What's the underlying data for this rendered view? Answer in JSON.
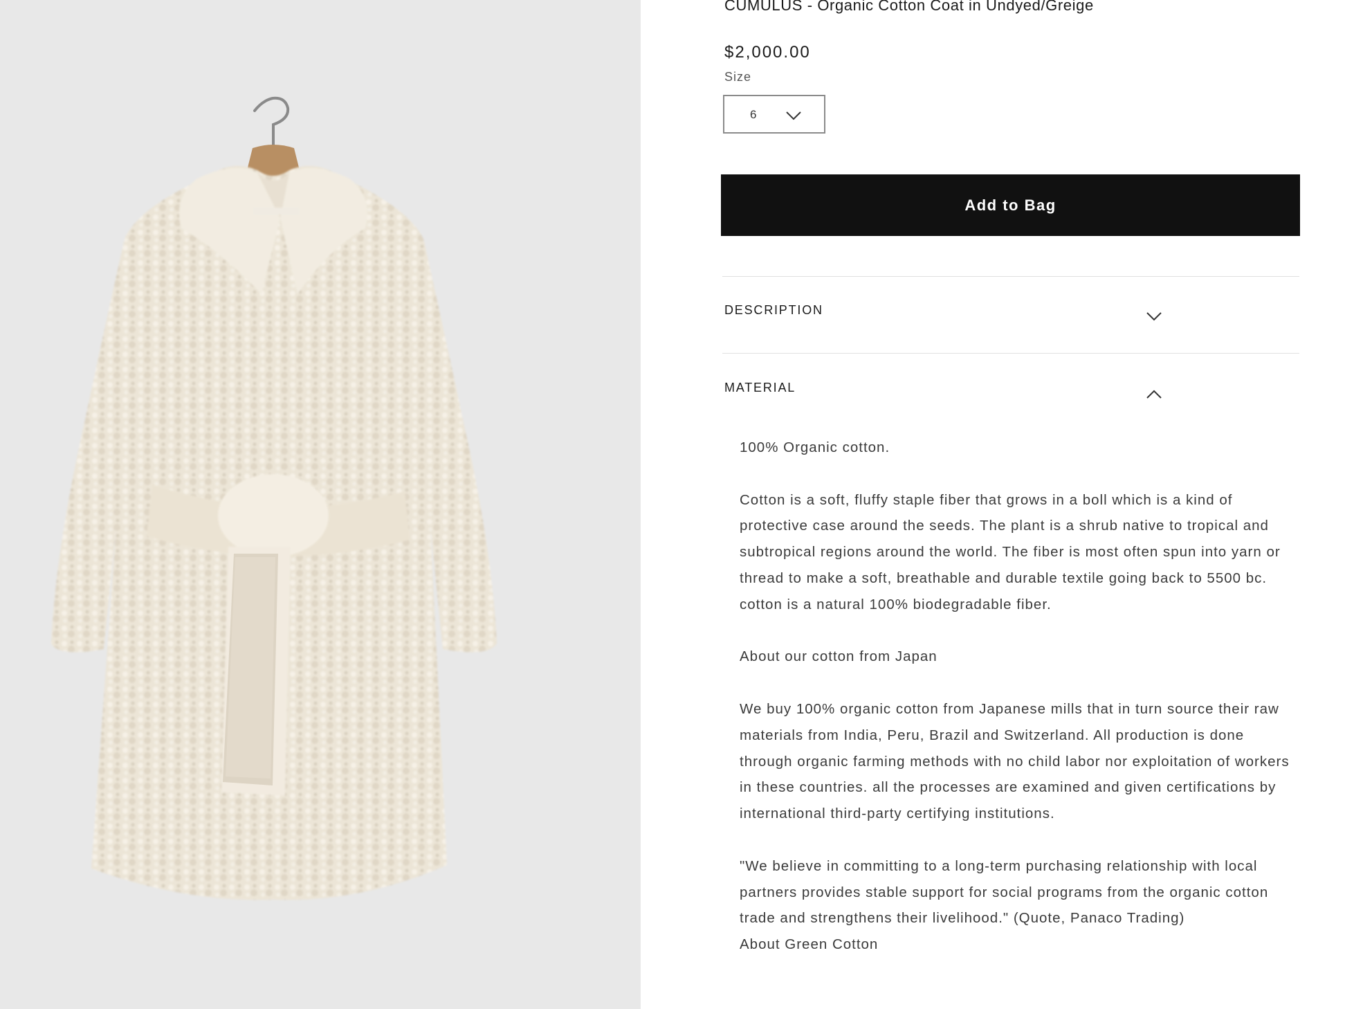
{
  "product": {
    "title": "CUMULUS - Organic Cotton Coat in Undyed/Greige",
    "price": "$2,000.00",
    "image_alt": "Fluffy cream organic cotton coat with belt on a wooden hanger"
  },
  "size": {
    "label": "Size",
    "selected": "6"
  },
  "add_to_bag_label": "Add to Bag",
  "accordions": {
    "description": {
      "title": "DESCRIPTION",
      "expanded": false
    },
    "material": {
      "title": "MATERIAL",
      "expanded": true
    }
  },
  "material": {
    "p1": "100% Organic cotton.",
    "p2": "Cotton is a soft, fluffy staple fiber that grows in a boll which is a kind of protective case around the seeds. The plant is a shrub native to tropical and subtropical regions around the world. The fiber is most often spun into yarn or thread to make a soft, breathable and durable textile going back to 5500 bc. cotton is a natural 100% biodegradable fiber.",
    "p3": "About our cotton from Japan",
    "p4": "We buy 100% organic cotton from Japanese mills that in turn source their raw materials from India, Peru, Brazil and Switzerland. All production is done through organic farming methods with no child labor nor exploitation of workers in these countries. all the processes are examined and given certifications by international third-party certifying institutions.",
    "p5": "\"We believe in committing to a long-term purchasing relationship with local partners provides stable support for social programs from the organic cotton trade and strengthens their livelihood.\" (Quote, Panaco Trading)",
    "p6": "About Green Cotton"
  },
  "icons": {
    "size_dropdown": "chevron-down-icon",
    "description_toggle": "chevron-down-icon",
    "material_toggle": "chevron-up-icon"
  },
  "colors": {
    "image_background": "#e8e8e8",
    "button_background": "#111111",
    "button_text": "#ffffff",
    "coat": "#ede6d8"
  }
}
